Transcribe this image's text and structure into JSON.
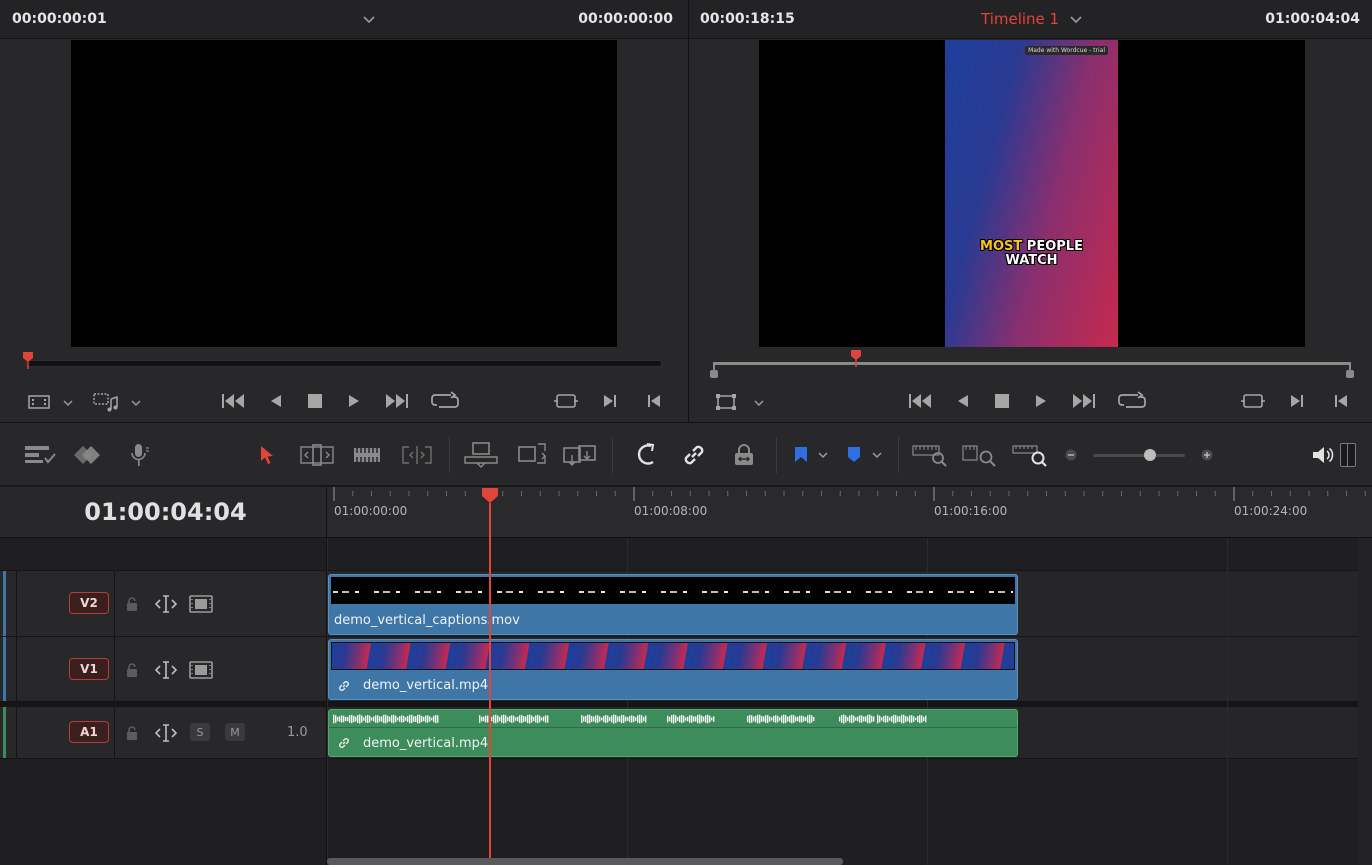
{
  "source_viewer": {
    "timecode_left": "00:00:00:01",
    "timecode_right": "00:00:00:00",
    "playhead_position": 0.0
  },
  "program_viewer": {
    "timecode_left": "00:00:18:15",
    "timeline_name": "Timeline 1",
    "timecode_right": "01:00:04:04",
    "preview_watermark": "Made with Wordcue - trial",
    "caption_highlight": "MOST",
    "caption_rest_line1": "PEOPLE",
    "caption_line2": "WATCH",
    "playhead_position": 0.22,
    "colors": {
      "timeline_name": "#e0453a",
      "caption_highlight": "#f5c518",
      "gradient_start": "#1d3f9c",
      "gradient_end": "#c6294f"
    }
  },
  "toolbar": {
    "left_icons": [
      "timeline-view-options-icon",
      "clip-mode-icon",
      "voiceover-mic-icon"
    ],
    "edit_tools": [
      "selection-arrow-icon",
      "trim-edit-icon",
      "dynamic-trim-icon",
      "blade-icon"
    ],
    "insert_tools": [
      "insert-clip-icon",
      "overwrite-clip-icon",
      "replace-clip-icon"
    ],
    "toggle_tools": [
      "snapping-icon",
      "linked-selection-icon",
      "position-lock-icon"
    ],
    "markers": [
      "flag-icon",
      "marker-icon"
    ],
    "zoom_tools": [
      "full-extent-zoom-icon",
      "detail-zoom-icon",
      "custom-zoom-icon"
    ],
    "zoom_level": 0.62,
    "colors": {
      "selection": "#e0453a",
      "flag": "#2f6fe0",
      "marker": "#2f6fe0"
    }
  },
  "timeline": {
    "current_timecode": "01:00:04:04",
    "ruler_labels": [
      "01:00:00:00",
      "01:00:08:00",
      "01:00:16:00",
      "01:00:24:00"
    ],
    "playhead_time_seconds": 4.17,
    "tracks": [
      {
        "id": "V2",
        "type": "video",
        "clip_name": "demo_vertical_captions.mov",
        "linked": false,
        "color": "#3e76a8"
      },
      {
        "id": "V1",
        "type": "video",
        "clip_name": "demo_vertical.mp4",
        "linked": true,
        "color": "#3e76a8"
      },
      {
        "id": "A1",
        "type": "audio",
        "clip_name": "demo_vertical.mp4",
        "linked": true,
        "volume": "1.0",
        "solo_label": "S",
        "mute_label": "M",
        "color": "#3d8c5c"
      }
    ],
    "clip_duration_seconds": 18.6,
    "colors": {
      "playhead": "#e0453a",
      "video_clip": "#3e76a8",
      "audio_clip": "#3d8c5c"
    }
  }
}
